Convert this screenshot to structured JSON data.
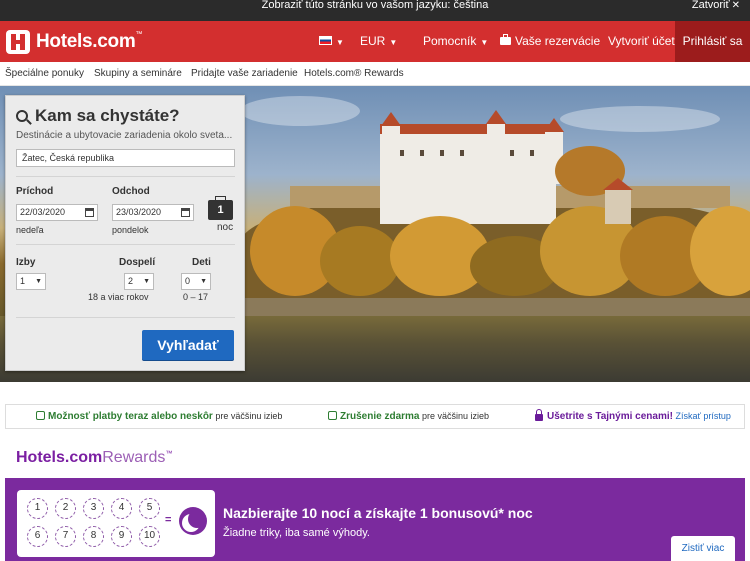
{
  "lang_bar": {
    "message": "Zobraziť túto stránku vo vašom jazyku: čeština",
    "close_label": "Zatvoriť"
  },
  "header": {
    "logo_text": "Hotels.com",
    "logo_tm": "™",
    "currency": "EUR",
    "help": "Pomocník",
    "reservations": "Vaše rezervácie",
    "create_account": "Vytvoriť účet",
    "sign_in": "Prihlásiť sa"
  },
  "subnav": [
    "Špeciálne ponuky",
    "Skupiny a semináre",
    "Pridajte vaše zariadenie",
    "Hotels.com® Rewards"
  ],
  "search": {
    "title": "Kam sa chystáte?",
    "subtitle": "Destinácie a ubytovacie zariadenia okolo sveta...",
    "destination_value": "Žatec, Česká republika",
    "checkin_label": "Príchod",
    "checkin_value": "22/03/2020",
    "checkin_day": "nedeľa",
    "checkout_label": "Odchod",
    "checkout_value": "23/03/2020",
    "checkout_day": "pondelok",
    "nights_count": "1",
    "nights_label": "noc",
    "rooms_label": "Izby",
    "rooms_value": "1",
    "adults_label": "Dospelí",
    "adults_value": "2",
    "adults_hint": "18 a viac rokov",
    "children_label": "Deti",
    "children_value": "0",
    "children_hint": "0 – 17",
    "button": "Vyhľadať"
  },
  "benefits": {
    "pay_bold": "Možnosť platby teraz alebo neskôr",
    "pay_rest": "pre väčšinu izieb",
    "cancel_bold": "Zrušenie zdarma",
    "cancel_rest": "pre väčšinu izieb",
    "secret_bold": "Ušetrite s Tajnými cenami!",
    "secret_link": "Získať prístup"
  },
  "rewards": {
    "logo_main": "Hotels.com",
    "logo_sub": "Rewards",
    "logo_tm": "™",
    "stamps": [
      "1",
      "2",
      "3",
      "4",
      "5",
      "6",
      "7",
      "8",
      "9",
      "10"
    ],
    "equals": "=",
    "title": "Nazbierajte 10 nocí a získajte 1 bonusovú* noc",
    "subtitle": "Žiadne triky, iba samé výhody.",
    "button": "Zistiť viac"
  },
  "colors": {
    "brand_red": "#d32f2f",
    "signin_red": "#9c1c1c",
    "search_blue": "#1f69c0",
    "rewards_purple": "#7b2a9e",
    "benefit_green": "#2e7d32"
  }
}
